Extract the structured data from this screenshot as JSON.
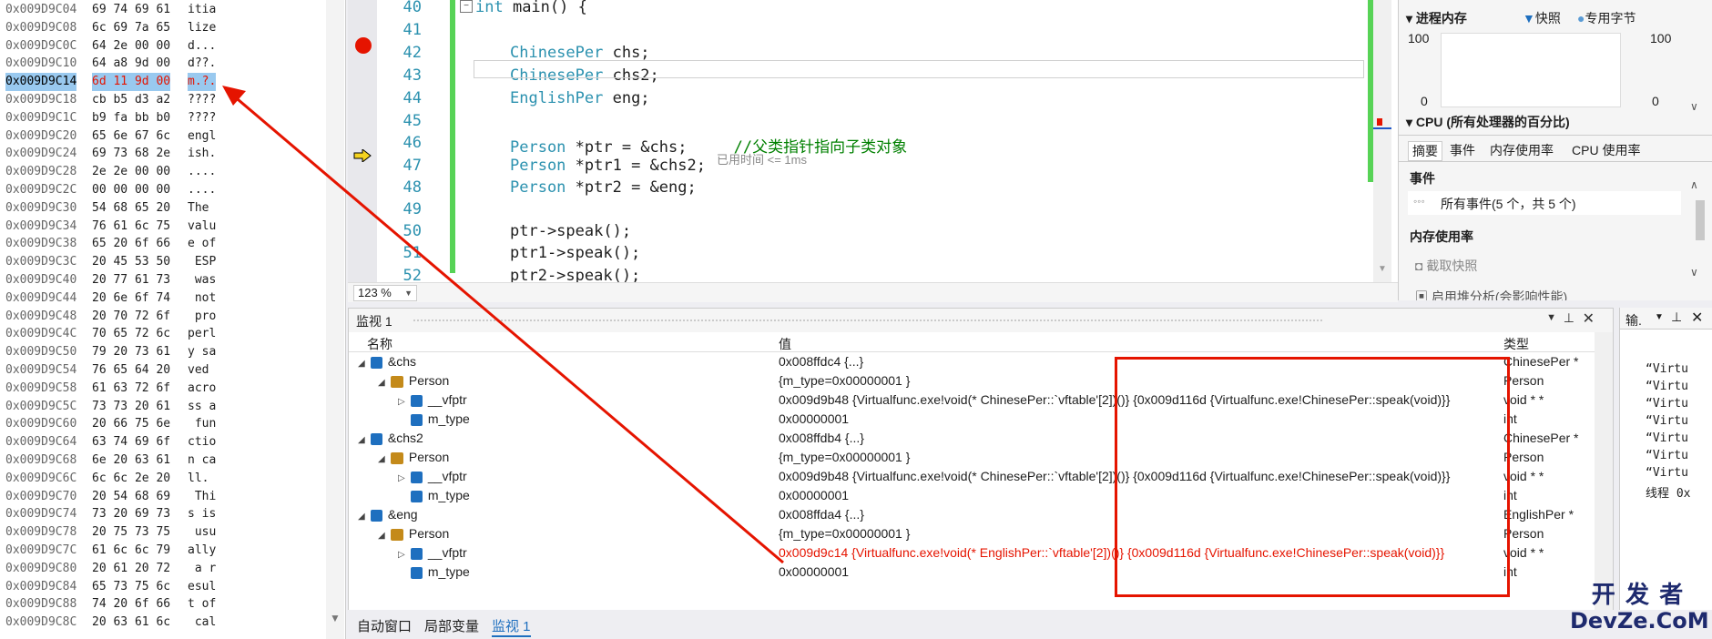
{
  "memory": {
    "rows": [
      {
        "addr": "0x009D9C04",
        "bytes": "69 74 69 61",
        "ascii": "itia"
      },
      {
        "addr": "0x009D9C08",
        "bytes": "6c 69 7a 65",
        "ascii": "lize"
      },
      {
        "addr": "0x009D9C0C",
        "bytes": "64 2e 00 00",
        "ascii": "d..."
      },
      {
        "addr": "0x009D9C10",
        "bytes": "64 a8 9d 00",
        "ascii": "d??."
      },
      {
        "addr": "0x009D9C14",
        "bytes": "6d 11 9d 00",
        "ascii": "m.?."
      },
      {
        "addr": "0x009D9C18",
        "bytes": "cb b5 d3 a2",
        "ascii": "????"
      },
      {
        "addr": "0x009D9C1C",
        "bytes": "b9 fa bb b0",
        "ascii": "????"
      },
      {
        "addr": "0x009D9C20",
        "bytes": "65 6e 67 6c",
        "ascii": "engl"
      },
      {
        "addr": "0x009D9C24",
        "bytes": "69 73 68 2e",
        "ascii": "ish."
      },
      {
        "addr": "0x009D9C28",
        "bytes": "2e 2e 00 00",
        "ascii": "...."
      },
      {
        "addr": "0x009D9C2C",
        "bytes": "00 00 00 00",
        "ascii": "...."
      },
      {
        "addr": "0x009D9C30",
        "bytes": "54 68 65 20",
        "ascii": "The "
      },
      {
        "addr": "0x009D9C34",
        "bytes": "76 61 6c 75",
        "ascii": "valu"
      },
      {
        "addr": "0x009D9C38",
        "bytes": "65 20 6f 66",
        "ascii": "e of"
      },
      {
        "addr": "0x009D9C3C",
        "bytes": "20 45 53 50",
        "ascii": " ESP"
      },
      {
        "addr": "0x009D9C40",
        "bytes": "20 77 61 73",
        "ascii": " was"
      },
      {
        "addr": "0x009D9C44",
        "bytes": "20 6e 6f 74",
        "ascii": " not"
      },
      {
        "addr": "0x009D9C48",
        "bytes": "20 70 72 6f",
        "ascii": " pro"
      },
      {
        "addr": "0x009D9C4C",
        "bytes": "70 65 72 6c",
        "ascii": "perl"
      },
      {
        "addr": "0x009D9C50",
        "bytes": "79 20 73 61",
        "ascii": "y sa"
      },
      {
        "addr": "0x009D9C54",
        "bytes": "76 65 64 20",
        "ascii": "ved "
      },
      {
        "addr": "0x009D9C58",
        "bytes": "61 63 72 6f",
        "ascii": "acro"
      },
      {
        "addr": "0x009D9C5C",
        "bytes": "73 73 20 61",
        "ascii": "ss a"
      },
      {
        "addr": "0x009D9C60",
        "bytes": "20 66 75 6e",
        "ascii": " fun"
      },
      {
        "addr": "0x009D9C64",
        "bytes": "63 74 69 6f",
        "ascii": "ctio"
      },
      {
        "addr": "0x009D9C68",
        "bytes": "6e 20 63 61",
        "ascii": "n ca"
      },
      {
        "addr": "0x009D9C6C",
        "bytes": "6c 6c 2e 20",
        "ascii": "ll. "
      },
      {
        "addr": "0x009D9C70",
        "bytes": "20 54 68 69",
        "ascii": " Thi"
      },
      {
        "addr": "0x009D9C74",
        "bytes": "73 20 69 73",
        "ascii": "s is"
      },
      {
        "addr": "0x009D9C78",
        "bytes": "20 75 73 75",
        "ascii": " usu"
      },
      {
        "addr": "0x009D9C7C",
        "bytes": "61 6c 6c 79",
        "ascii": "ally"
      },
      {
        "addr": "0x009D9C80",
        "bytes": "20 61 20 72",
        "ascii": " a r"
      },
      {
        "addr": "0x009D9C84",
        "bytes": "65 73 75 6c",
        "ascii": "esul"
      },
      {
        "addr": "0x009D9C88",
        "bytes": "74 20 6f 66",
        "ascii": "t of"
      },
      {
        "addr": "0x009D9C8C",
        "bytes": "20 63 61 6c",
        "ascii": " cal"
      }
    ]
  },
  "editor": {
    "lines": [
      {
        "n": "40",
        "code": "int main() {"
      },
      {
        "n": "41",
        "code": ""
      },
      {
        "n": "42",
        "code": "ChinesePer chs;"
      },
      {
        "n": "43",
        "code": "ChinesePer chs2;"
      },
      {
        "n": "44",
        "code": "EnglishPer eng;"
      },
      {
        "n": "45",
        "code": ""
      },
      {
        "n": "46",
        "code": "Person *ptr = &chs;     //父类指针指向子类对象"
      },
      {
        "n": "47",
        "code": "Person *ptr1 = &chs2;"
      },
      {
        "n": "48",
        "code": "Person *ptr2 = &eng;"
      },
      {
        "n": "49",
        "code": ""
      },
      {
        "n": "50",
        "code": "ptr->speak();"
      },
      {
        "n": "51",
        "code": "ptr1->speak();"
      },
      {
        "n": "52",
        "code": "ptr2->speak();"
      }
    ],
    "elapsed": "已用时间 <= 1ms",
    "zoom": "123 %"
  },
  "diag": {
    "process_memory": "进程内存",
    "snapshot": "快照",
    "private_bytes": "专用字节",
    "y_top_left": "100",
    "y_bottom_left": "0",
    "y_top_right": "100",
    "y_bottom_right": "0",
    "cpu_title": "CPU (所有处理器的百分比)",
    "tabs": [
      "摘要",
      "事件",
      "内存使用率",
      "CPU 使用率"
    ],
    "events_header": "事件",
    "all_events": "所有事件(5 个，共 5 个)",
    "mem_usage_header": "内存使用率",
    "take_snapshot": "截取快照",
    "enable_heap": "启用堆分析(会影响性能)"
  },
  "watch": {
    "title": "监视 1",
    "col_name": "名称",
    "col_value": "值",
    "col_type": "类型",
    "rows": [
      {
        "name": "&chs",
        "value": "0x008ffdc4 {...}",
        "type": "ChinesePer *"
      },
      {
        "name": "Person",
        "value": "{m_type=0x00000001 }",
        "type": "Person"
      },
      {
        "name": "__vfptr",
        "value": "0x009d9b48 {Virtualfunc.exe!void(* ChinesePer::`vftable'[2])()} {0x009d116d {Virtualfunc.exe!ChinesePer::speak(void)}}",
        "type": "void * *"
      },
      {
        "name": "m_type",
        "value": "0x00000001",
        "type": "int"
      },
      {
        "name": "&chs2",
        "value": "0x008ffdb4 {...}",
        "type": "ChinesePer *"
      },
      {
        "name": "Person",
        "value": "{m_type=0x00000001 }",
        "type": "Person"
      },
      {
        "name": "__vfptr",
        "value": "0x009d9b48 {Virtualfunc.exe!void(* ChinesePer::`vftable'[2])()} {0x009d116d {Virtualfunc.exe!ChinesePer::speak(void)}}",
        "type": "void * *"
      },
      {
        "name": "m_type",
        "value": "0x00000001",
        "type": "int"
      },
      {
        "name": "&eng",
        "value": "0x008ffda4 {...}",
        "type": "EnglishPer *"
      },
      {
        "name": "Person",
        "value": "{m_type=0x00000001 }",
        "type": "Person"
      },
      {
        "name": "__vfptr",
        "value": "0x009d9c14 {Virtualfunc.exe!void(* EnglishPer::`vftable'[2])()} {0x009d116d {Virtualfunc.exe!ChinesePer::speak(void)}}",
        "type": "void * *"
      },
      {
        "name": "m_type",
        "value": "0x00000001",
        "type": "int"
      }
    ]
  },
  "bottom_tabs": [
    "自动窗口",
    "局部变量",
    "监视 1"
  ],
  "output": {
    "title": "输.",
    "lines": [
      "“Virtu",
      "“Virtu",
      "“Virtu",
      "“Virtu",
      "“Virtu",
      "“Virtu",
      "“Virtu",
      "线程 0x"
    ]
  },
  "watermark": {
    "line1": "开 发 者",
    "line2": "DevZe.CoM"
  },
  "colors": {
    "accent": "#007acc",
    "highlight": "#e51400",
    "selection": "#99c9ef"
  }
}
